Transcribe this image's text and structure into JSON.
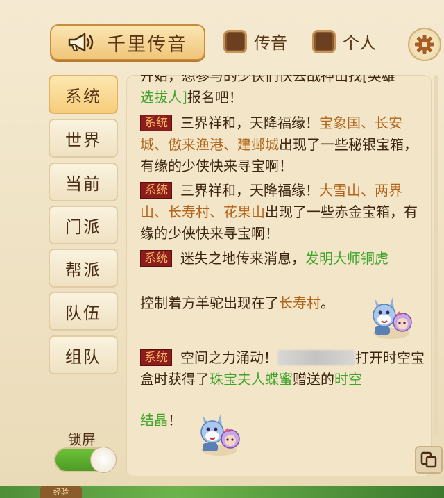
{
  "header": {
    "broadcast_label": "千里传音",
    "chuanyin_label": "传音",
    "geren_label": "个人"
  },
  "sidebar": {
    "tabs": [
      {
        "label": "系统",
        "active": true
      },
      {
        "label": "世界",
        "active": false
      },
      {
        "label": "当前",
        "active": false
      },
      {
        "label": "门派",
        "active": false
      },
      {
        "label": "帮派",
        "active": false
      },
      {
        "label": "队伍",
        "active": false
      },
      {
        "label": "组队",
        "active": false
      }
    ],
    "lock_label": "锁屏",
    "lock_on": true
  },
  "chat": {
    "system_tag": "系统",
    "m0": {
      "line1_cut": "开始，想参与的少侠们快去战神山找[英雄",
      "link": "选拔人]",
      "rest": "报名吧！"
    },
    "m1": {
      "text1": "三界祥和，天降福缘！",
      "place": "宝象国、长安城、傲来渔港、建邺城",
      "text2": "出现了一些秘银宝箱，有缘的少侠快来寻宝啊！"
    },
    "m2": {
      "text1": "三界祥和，天降福缘！",
      "place": "大雪山、两界山、长寿村、花果山",
      "text2": "出现了一些赤金宝箱，有缘的少侠快来寻宝啊！"
    },
    "m3": {
      "text1": "迷失之地传来消息，",
      "npc": "发明大师铜虎"
    },
    "m3b": {
      "text1": "控制着方羊驼出现在了",
      "place": "长寿村",
      "text2": "。"
    },
    "m4": {
      "text1": "空间之力涌动！",
      "text2": "打开时空宝盒时获得了",
      "npc": "珠宝夫人蝶蜜",
      "text3": "赠送的",
      "item1": "时空",
      "item2": "结晶",
      "text4": "！"
    }
  },
  "bottom": {
    "item_label": "经验"
  },
  "colors": {
    "system_tag_bg": "#8b1d1a",
    "place_text": "#b2641a",
    "npc_text": "#3fa32c",
    "toggle_on": "#5aad2f"
  },
  "icons": [
    "horn-icon",
    "gear-icon",
    "copy-icon",
    "emote-icon"
  ]
}
